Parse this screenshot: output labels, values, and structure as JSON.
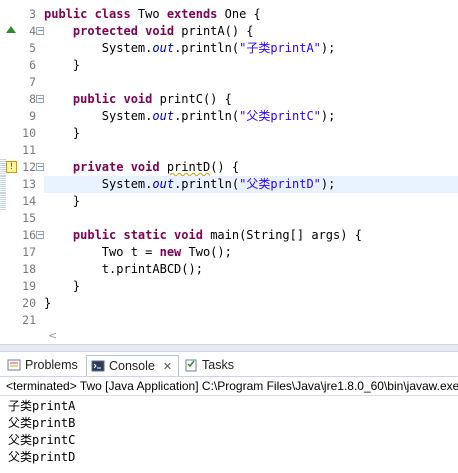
{
  "editor": {
    "lines": [
      {
        "num": "3",
        "segments": [
          {
            "t": "public class ",
            "c": "kw"
          },
          {
            "t": "Two ",
            "c": ""
          },
          {
            "t": "extends ",
            "c": "kw"
          },
          {
            "t": "One {",
            "c": ""
          }
        ]
      },
      {
        "num": "4",
        "segments": [
          {
            "t": "    ",
            "c": ""
          },
          {
            "t": "protected void ",
            "c": "kw"
          },
          {
            "t": "printA() {",
            "c": ""
          }
        ]
      },
      {
        "num": "5",
        "segments": [
          {
            "t": "        System.",
            "c": ""
          },
          {
            "t": "out",
            "c": "fld"
          },
          {
            "t": ".println(",
            "c": ""
          },
          {
            "t": "\"子类printA\"",
            "c": "str"
          },
          {
            "t": ");",
            "c": ""
          }
        ]
      },
      {
        "num": "6",
        "segments": [
          {
            "t": "    }",
            "c": ""
          }
        ]
      },
      {
        "num": "7",
        "segments": []
      },
      {
        "num": "8",
        "segments": [
          {
            "t": "    ",
            "c": ""
          },
          {
            "t": "public void ",
            "c": "kw"
          },
          {
            "t": "printC() {",
            "c": ""
          }
        ]
      },
      {
        "num": "9",
        "segments": [
          {
            "t": "        System.",
            "c": ""
          },
          {
            "t": "out",
            "c": "fld"
          },
          {
            "t": ".println(",
            "c": ""
          },
          {
            "t": "\"父类printC\"",
            "c": "str"
          },
          {
            "t": ");",
            "c": ""
          }
        ]
      },
      {
        "num": "10",
        "segments": [
          {
            "t": "    }",
            "c": ""
          }
        ]
      },
      {
        "num": "11",
        "segments": []
      },
      {
        "num": "12",
        "segments": [
          {
            "t": "    ",
            "c": ""
          },
          {
            "t": "private void ",
            "c": "kw"
          },
          {
            "t": "printD",
            "c": "warn"
          },
          {
            "t": "() {",
            "c": ""
          }
        ]
      },
      {
        "num": "13",
        "segments": [
          {
            "t": "        System.",
            "c": ""
          },
          {
            "t": "out",
            "c": "fld"
          },
          {
            "t": ".println(",
            "c": ""
          },
          {
            "t": "\"父类printD\"",
            "c": "str"
          },
          {
            "t": ");",
            "c": ""
          }
        ]
      },
      {
        "num": "14",
        "segments": [
          {
            "t": "    }",
            "c": ""
          }
        ]
      },
      {
        "num": "15",
        "segments": []
      },
      {
        "num": "16",
        "segments": [
          {
            "t": "    ",
            "c": ""
          },
          {
            "t": "public static void ",
            "c": "kw"
          },
          {
            "t": "main(String[] ",
            "c": ""
          },
          {
            "t": "args",
            "c": ""
          },
          {
            "t": ") {",
            "c": ""
          }
        ]
      },
      {
        "num": "17",
        "segments": [
          {
            "t": "        Two t = ",
            "c": ""
          },
          {
            "t": "new ",
            "c": "kw"
          },
          {
            "t": "Two();",
            "c": ""
          }
        ]
      },
      {
        "num": "18",
        "segments": [
          {
            "t": "        t.printABCD();",
            "c": ""
          }
        ]
      },
      {
        "num": "19",
        "segments": [
          {
            "t": "    }",
            "c": ""
          }
        ]
      },
      {
        "num": "20",
        "segments": [
          {
            "t": "}",
            "c": ""
          }
        ]
      },
      {
        "num": "21",
        "segments": []
      }
    ],
    "fold_lines": [
      "4",
      "8",
      "12",
      "16"
    ],
    "override_marker_line": "4",
    "warning_marker_line": "12",
    "current_line": "13",
    "scroll_left_glyph": "<"
  },
  "panel": {
    "tabs": [
      {
        "label": "Problems",
        "icon": "problems-icon",
        "active": false
      },
      {
        "label": "Console",
        "icon": "console-icon",
        "active": true,
        "close": "✕"
      },
      {
        "label": "Tasks",
        "icon": "tasks-icon",
        "active": false
      }
    ],
    "console_header": "<terminated> Two [Java Application] C:\\Program Files\\Java\\jre1.8.0_60\\bin\\javaw.exe",
    "output": [
      "子类printA",
      "父类printB",
      "父类printC",
      "父类printD"
    ]
  },
  "colors": {
    "keyword": "#7f0055",
    "string": "#2a00ff",
    "field": "#0000c0",
    "current_line_bg": "#e8f2fe"
  }
}
